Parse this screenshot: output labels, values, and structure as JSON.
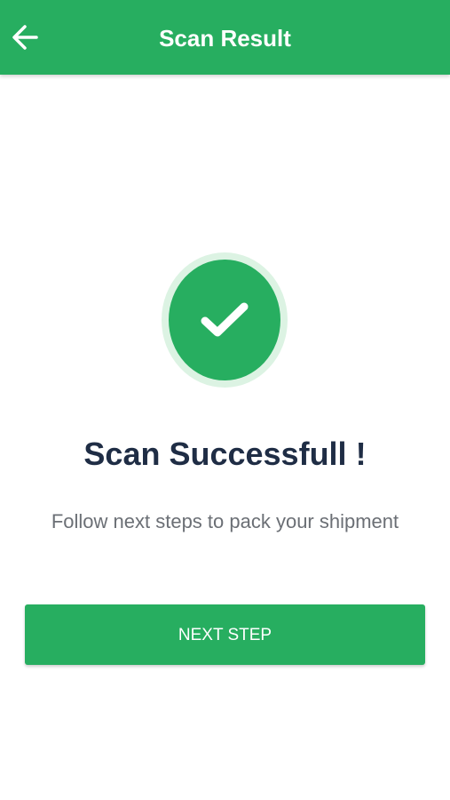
{
  "header": {
    "title": "Scan Result",
    "back_icon": "arrow-left-icon"
  },
  "status": {
    "icon": "check-icon",
    "headline": "Scan Successfull !",
    "message": "Follow next steps to pack your shipment"
  },
  "actions": {
    "next_label": "NEXT STEP"
  },
  "colors": {
    "primary": "#27ae60",
    "primary_light": "#dcf3e3",
    "headline_text": "#1f2d45",
    "body_text": "#6b6f75"
  }
}
